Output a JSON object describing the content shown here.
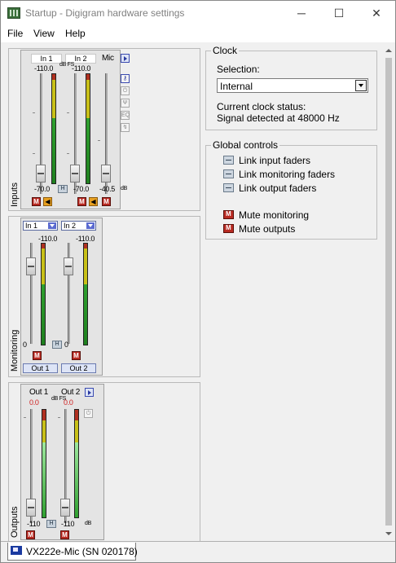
{
  "window": {
    "title": "Startup - Digigram hardware settings",
    "minimize": "─",
    "maximize": "☐",
    "close": "✕"
  },
  "menu": [
    "File",
    "View",
    "Help"
  ],
  "inputs": {
    "section_label": "Inputs",
    "headers": [
      "In 1",
      "In 2",
      "Mic"
    ],
    "top_values": [
      "-110.0",
      "-110.0"
    ],
    "db_scale": "dB FS",
    "bottom_values": [
      "-70.0",
      "-70.0",
      "-40.5"
    ],
    "db_unit": "dB",
    "link_label": "H",
    "mute_label": "M",
    "listen_label": "◀"
  },
  "monitoring": {
    "section_label": "Monitoring",
    "selects": [
      "In 1",
      "In 2"
    ],
    "top_values": [
      "-110.0",
      "-110.0"
    ],
    "bottom_values": [
      "0",
      "0"
    ],
    "outputs": [
      "Out 1",
      "Out 2"
    ],
    "mute_label": "M",
    "link_label": "H"
  },
  "outputs": {
    "section_label": "Outputs",
    "headers": [
      "Out 1",
      "Out 2"
    ],
    "top_values": [
      "0.0",
      "0.0"
    ],
    "db_scale": "dB FS",
    "bottom_values": [
      "-110",
      "-110"
    ],
    "db_unit": "dB",
    "link_label": "H",
    "mute_label": "M"
  },
  "clock": {
    "title": "Clock",
    "selection_label": "Selection:",
    "selection_value": "Internal",
    "status_label": "Current clock status:",
    "status_value": "Signal detected at 48000 Hz"
  },
  "global_controls": {
    "title": "Global controls",
    "link_items": [
      "Link input faders",
      "Link monitoring faders",
      "Link output faders"
    ],
    "mute_items": [
      "Mute monitoring",
      "Mute outputs"
    ]
  },
  "tab": {
    "label": "VX222e-Mic (SN 020178)"
  },
  "colors": {
    "mute_red": "#b82a22",
    "meter_green": "#2fa02f",
    "meter_yellow": "#c8c018",
    "meter_red": "#b03020",
    "peak_red": "#d02020"
  }
}
